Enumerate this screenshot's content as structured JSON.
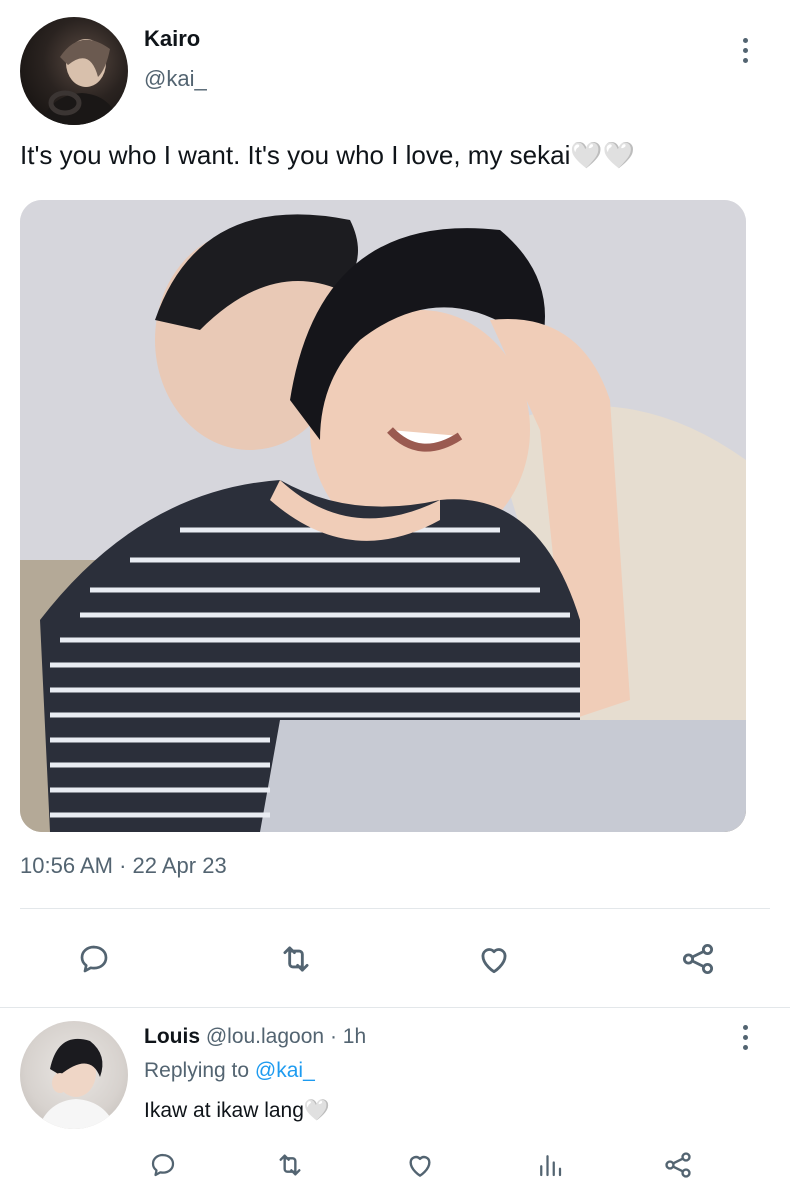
{
  "tweet": {
    "author_name": "Kairo",
    "author_handle": "@kai_",
    "text": "It's you who I want. It's you who I love, my sekai🤍🤍",
    "timestamp": "10:56 AM · 22 Apr 23"
  },
  "reply": {
    "author_name": "Louis",
    "author_handle": "@lou.lagoon",
    "age": "· 1h",
    "replying_to_prefix": "Replying to ",
    "replying_to_handle": "@kai_",
    "text": "Ikaw at ikaw lang🤍"
  },
  "icons": {
    "reply": "speech-bubble-icon",
    "retweet": "retweet-icon",
    "like": "heart-icon",
    "share": "share-icon",
    "views": "bar-chart-icon",
    "menu": "more-vertical-icon"
  },
  "colors": {
    "text": "#0f1419",
    "secondary": "#536471",
    "link": "#1d9bf0",
    "divider": "#e3e7ea"
  }
}
